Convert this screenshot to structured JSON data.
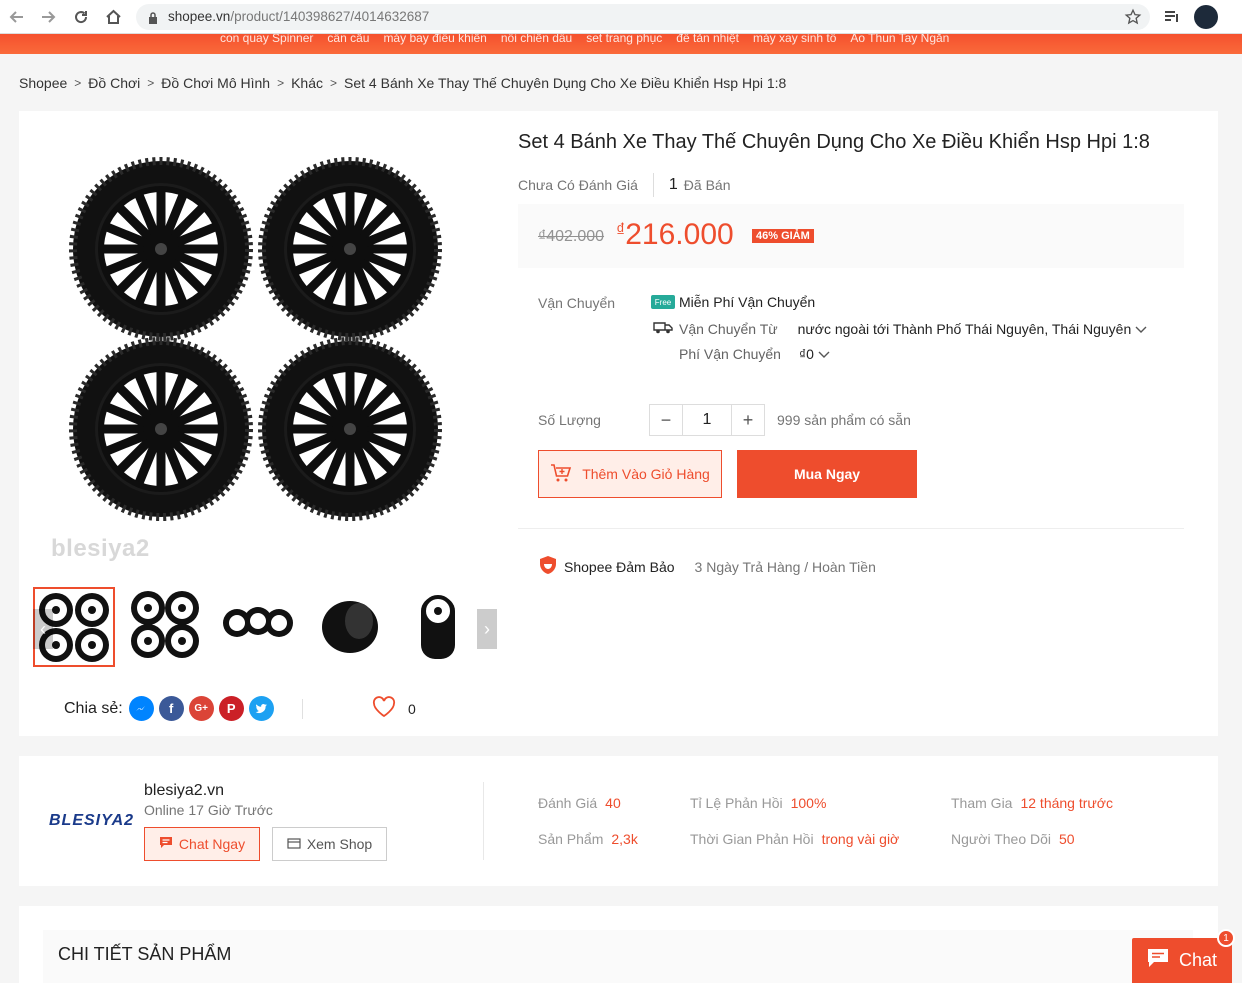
{
  "browser": {
    "url_host": "shopee.vn",
    "url_path": "/product/140398627/4014632687"
  },
  "header_strip": {
    "links": [
      "con quay Spinner",
      "cần câu",
      "máy bay điều khiển",
      "nồi chiên dầu",
      "set trang phục",
      "đế tản nhiệt",
      "máy xay sinh tố",
      "Áo Thun Tay Ngắn"
    ]
  },
  "breadcrumb": [
    "Shopee",
    "Đồ Chơi",
    "Đồ Chơi Mô Hình",
    "Khác",
    "Set 4 Bánh Xe Thay Thế Chuyên Dụng Cho Xe Điều Khiển Hsp Hpi 1:8"
  ],
  "product": {
    "title": "Set 4 Bánh Xe Thay Thế Chuyên Dụng Cho Xe Điều Khiển Hsp Hpi 1:8",
    "rating_text": "Chưa Có Đánh Giá",
    "sold_count": "1",
    "sold_label": "Đã Bán",
    "old_price": "₫402.000",
    "currency": "₫",
    "price": "216.000",
    "discount": "46% GIẢM",
    "watermark": "blesiya2",
    "share_label": "Chia sẻ:",
    "likes": "0"
  },
  "shipping": {
    "label": "Vận Chuyển",
    "free_badge": "Free",
    "free_text": "Miễn Phí Vận Chuyển",
    "from_label": "Vận Chuyển Từ",
    "from_value": "nước ngoài tới Thành Phố Thái Nguyên, Thái Nguyên",
    "fee_label": "Phí Vận Chuyển",
    "fee_value": "₫0"
  },
  "quantity": {
    "label": "Số Lượng",
    "value": "1",
    "minus": "−",
    "plus": "+",
    "stock": "999 sản phẩm có sẵn"
  },
  "actions": {
    "add_to_cart": "Thêm Vào Giỏ Hàng",
    "buy_now": "Mua Ngay"
  },
  "guarantee": {
    "label": "Shopee Đảm Bảo",
    "desc": "3 Ngày Trả Hàng / Hoàn Tiền"
  },
  "shop": {
    "logo": "BLESIYA2",
    "name": "blesiya2.vn",
    "online": "Online 17 Giờ Trước",
    "chat_btn": "Chat Ngay",
    "view_btn": "Xem Shop",
    "stats": [
      {
        "label": "Đánh Giá",
        "value": "40"
      },
      {
        "label": "Tỉ Lệ Phản Hồi",
        "value": "100%"
      },
      {
        "label": "Tham Gia",
        "value": "12 tháng trước"
      },
      {
        "label": "Sản Phẩm",
        "value": "2,3k"
      },
      {
        "label": "Thời Gian Phản Hồi",
        "value": "trong vài giờ"
      },
      {
        "label": "Người Theo Dõi",
        "value": "50"
      }
    ]
  },
  "details": {
    "heading": "CHI TIẾT SẢN PHẨM"
  },
  "chat_float": {
    "label": "Chat",
    "badge": "1"
  },
  "colors": {
    "brand": "#ee4d2d",
    "free_ship": "#26aa99"
  }
}
